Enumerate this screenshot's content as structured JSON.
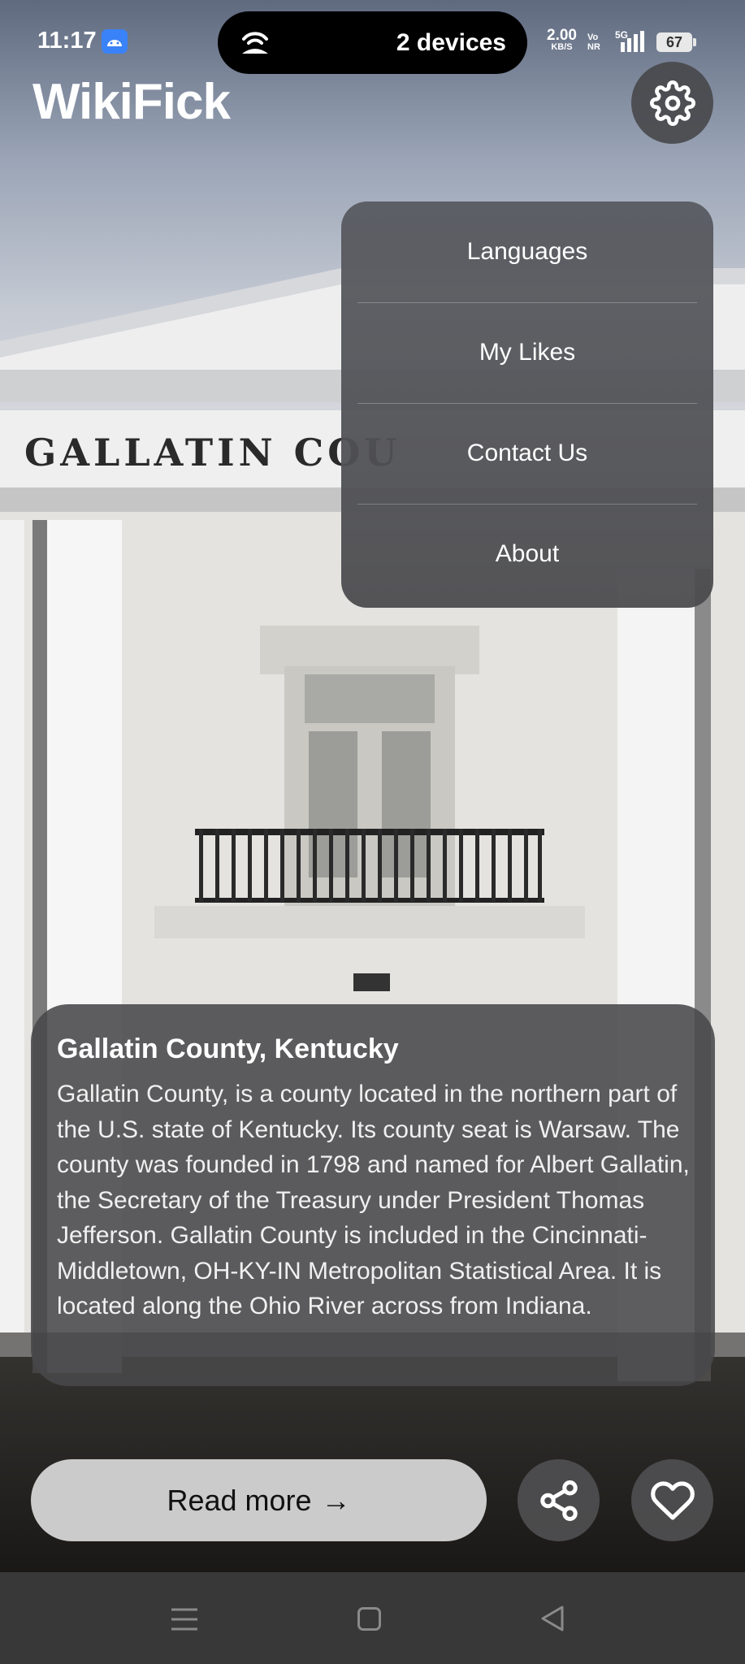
{
  "status_bar": {
    "time": "11:17",
    "island_text": "2 devices",
    "network_speed": "2.00",
    "network_speed_unit": "KB/S",
    "volte_top": "Vo",
    "volte_bottom": "NR",
    "network_type": "5G",
    "battery": "67"
  },
  "app": {
    "title": "WikiFick"
  },
  "menu": {
    "items": [
      {
        "label": "Languages"
      },
      {
        "label": "My Likes"
      },
      {
        "label": "Contact Us"
      },
      {
        "label": "About"
      }
    ]
  },
  "article": {
    "image_sign_text": "GALLATIN COU",
    "title": "Gallatin County, Kentucky",
    "summary": "Gallatin County, is a county located in the northern part of the U.S. state of Kentucky. Its county seat is Warsaw. The county was founded in 1798 and named for Albert Gallatin, the Secretary of the Treasury under President Thomas Jefferson. Gallatin County is included in the Cincinnati-Middletown, OH-KY-IN Metropolitan Statistical Area. It is located along the Ohio River across from Indiana."
  },
  "actions": {
    "read_more_label": "Read more",
    "read_more_arrow": "→"
  },
  "icons": {
    "settings": "gear-icon",
    "share": "share-icon",
    "like": "heart-icon",
    "hotspot": "hotspot-icon",
    "android": "android-icon"
  }
}
